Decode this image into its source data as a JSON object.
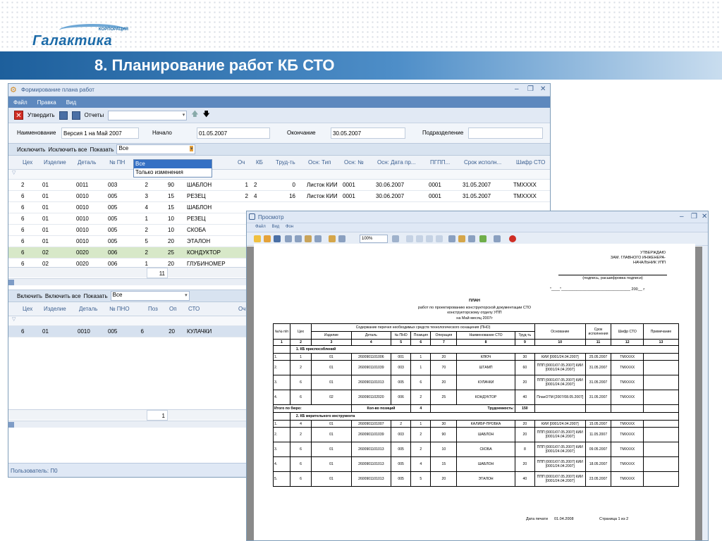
{
  "slide": {
    "logo_sub": "КОРПОРАЦИЯ",
    "logo_name": "Галактика",
    "title": "8. Планирование работ КБ СТО"
  },
  "main_window": {
    "caption": "Формирование плана работ",
    "menu": [
      "Файл",
      "Правка",
      "Вид"
    ],
    "toolbar": {
      "approve": "Утвердить",
      "reports": "Отчеты"
    },
    "form": {
      "name_label": "Наименование",
      "name_value": "Версия 1 на Май 2007",
      "start_label": "Начало",
      "start_value": "01.05.2007",
      "end_label": "Окончание",
      "end_value": "30.05.2007",
      "dept_label": "Подразделение",
      "dept_value": ""
    },
    "filter1": {
      "exclude": "Исключить",
      "exclude_all": "Исключить все",
      "show": "Показать",
      "show_value": "Все"
    },
    "dropdown": [
      "Все",
      "Только изменения"
    ],
    "grid1_cols": [
      "Цех",
      "Изделие",
      "Деталь",
      "№ ПН",
      "Оч",
      "КБ",
      "Труд-ть",
      "Осн: Тип",
      "Осн: №",
      "Осн: Дата пр...",
      "ПГПП...",
      "Срок исполн...",
      "Шифр СТО"
    ],
    "grid1_rows": [
      [
        "2",
        "01",
        "0011",
        "003",
        "2",
        "90",
        "ШАБЛОН",
        "1",
        "2",
        "0",
        "Листок КИИ",
        "0001",
        "30.06.2007",
        "0001",
        "31.05.2007",
        "ТМХХХХ"
      ],
      [
        "6",
        "01",
        "0010",
        "005",
        "3",
        "15",
        "РЕЗЕЦ",
        "2",
        "4",
        "16",
        "Листок КИИ",
        "0001",
        "30.06.2007",
        "0001",
        "31.05.2007",
        "ТМХХХХ"
      ],
      [
        "6",
        "01",
        "0010",
        "005",
        "4",
        "15",
        "ШАБЛОН"
      ],
      [
        "6",
        "01",
        "0010",
        "005",
        "1",
        "10",
        "РЕЗЕЦ"
      ],
      [
        "6",
        "01",
        "0010",
        "005",
        "2",
        "10",
        "СКОБА"
      ],
      [
        "6",
        "01",
        "0010",
        "005",
        "5",
        "20",
        "ЭТАЛОН"
      ],
      [
        "6",
        "02",
        "0020",
        "006",
        "2",
        "25",
        "КОНДУКТОР"
      ],
      [
        "6",
        "02",
        "0020",
        "006",
        "1",
        "20",
        "ГЛУБИНОМЕР"
      ]
    ],
    "grid1_count": "11",
    "filter2": {
      "include": "Включить",
      "include_all": "Включить все",
      "show": "Показать",
      "show_value": "Все"
    },
    "grid2_cols": [
      "Цех",
      "Изделие",
      "Деталь",
      "№ ПНО",
      "Поз",
      "Оп",
      "СТО",
      "Оч"
    ],
    "grid2_rows": [
      [
        "6",
        "01",
        "0010",
        "005",
        "6",
        "20",
        "КУЛАЧКИ"
      ]
    ],
    "grid2_count": "1",
    "status": "Пользователь: П0"
  },
  "preview": {
    "caption": "Просмотр",
    "menu": [
      "Файл",
      "Вид",
      "Фон"
    ],
    "zoom": "100%",
    "approve": [
      "УТВЕРЖДАЮ",
      "ЗАМ. ГЛАВНОГО ИНЖЕНЕРА-",
      "НАЧАЛЬНИК УПП"
    ],
    "sign": "(подпись, расшифровка подписи)",
    "date_line": "\"____\"________________________________ 200__ г",
    "plan": "ПЛАН",
    "plan_sub1": "работ по проектированию конструкторской документации СТО",
    "plan_sub2": "конструкторскому отделу УПП",
    "plan_month": "на Май месяц 2007г",
    "head1": [
      "№№ п/п",
      "Цех",
      "Содержание перечня необходимых средств технологического оснащения (ПНО)",
      "Основание",
      "Срок исполнения",
      "Шифр СТО",
      "Примечание"
    ],
    "head2": [
      "Изделие",
      "Деталь",
      "№ ПНО",
      "Позиция",
      "Операция",
      "Наименование СТО",
      "Труд-ть"
    ],
    "nums": [
      "1",
      "2",
      "3",
      "4",
      "5",
      "6",
      "7",
      "8",
      "9",
      "10",
      "11",
      "12",
      "13"
    ],
    "group1": "1. КБ приспособлений",
    "rows1": [
      [
        "1.",
        "1",
        "01",
        "2600901101006",
        "001",
        "1",
        "20",
        "КЛЮЧ",
        "30",
        "КИИ [0001/24.04.2007]",
        "25.05.2007",
        "ТМХХХХ"
      ],
      [
        "2.",
        "2",
        "01",
        "2600901101039",
        "003",
        "1",
        "70",
        "ШТАМП",
        "60",
        "ППП [0001/07.05.2007] КИИ [0001/24.04.2007]",
        "31.05.2007",
        "ТМХХХХ"
      ],
      [
        "3.",
        "6",
        "01",
        "2600901101013",
        "005",
        "6",
        "20",
        "КУЛАЧКИ",
        "20",
        "ППП [0001/07.05.2007] КИИ [0001/24.04.2007]",
        "31.05.2007",
        "ТМХХХХ"
      ],
      [
        "4.",
        "6",
        "02",
        "2600901102020",
        "006",
        "2",
        "25",
        "КОНДУКТОР",
        "40",
        "ПланОТМ [2007/08.05.2007]",
        "31.05.2007",
        "ТМХХХХ"
      ]
    ],
    "total": {
      "label": "Итого по бюро:",
      "count_label": "Кол-во позиций",
      "count": "4",
      "labor_label": "Трудоемкость:",
      "labor": "150"
    },
    "group2": "2. КБ мерительного инструмента",
    "rows2": [
      [
        "1.",
        "4",
        "01",
        "2600901101007",
        "2",
        "1",
        "30",
        "КАЛИБР-ПРОБКА",
        "20",
        "КИИ [0001/24.04.2007]",
        "15.05.2007",
        "ТМХХХХ"
      ],
      [
        "2.",
        "2",
        "01",
        "2600901101039",
        "003",
        "2",
        "90",
        "ШАБЛОН",
        "20",
        "ППП [0001/07.05.2007] КИИ [0001/24.04.2007]",
        "11.05.2007",
        "ТМХХХХ"
      ],
      [
        "3.",
        "6",
        "01",
        "2600901101013",
        "005",
        "2",
        "10",
        "СКОБА",
        "8",
        "ППП [0001/07.05.2007] КИИ [0001/24.04.2007]",
        "09.05.2007",
        "ТМХХХХ"
      ],
      [
        "4.",
        "6",
        "01",
        "2600901101013",
        "005",
        "4",
        "15",
        "ШАБЛОН",
        "20",
        "ППП [0001/07.05.2007] КИИ [0001/24.04.2007]",
        "18.05.2007",
        "ТМХХХХ"
      ],
      [
        "5.",
        "6",
        "01",
        "2600901101013",
        "005",
        "5",
        "20",
        "ЭТАЛОН",
        "40",
        "ППП [0001/07.05.2007] КИИ [0001/24.04.2007]",
        "23.05.2007",
        "ТМХХХХ"
      ]
    ],
    "print_date_label": "Дата печати",
    "print_date": "01.04.2008",
    "page": "Страница 1 из 2"
  }
}
